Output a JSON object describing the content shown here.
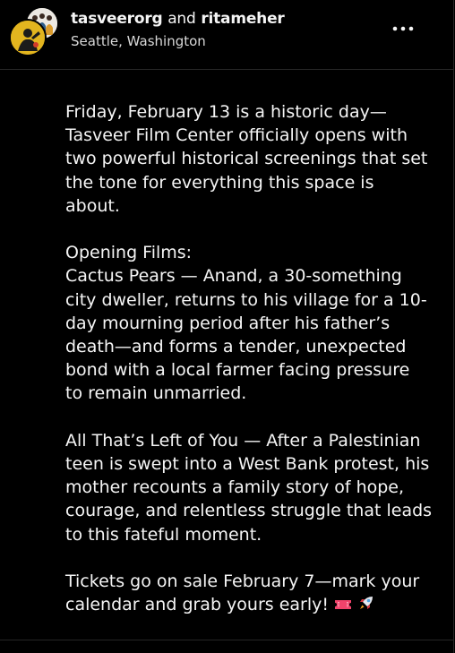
{
  "header": {
    "user_primary": "tasveerorg",
    "conjunction": "and",
    "user_secondary": "ritameher",
    "location": "Seattle, Washington",
    "more_icon": "more-horizontal-icon"
  },
  "caption": {
    "paragraphs": [
      {
        "lines": [
          "Friday, February 13 is a historic day—",
          "Tasveer Film Center officially opens with",
          "two powerful historical screenings that set",
          "the tone for everything this space is",
          "about."
        ]
      },
      {
        "lines": [
          "Opening Films:",
          "Cactus Pears — Anand, a 30-something",
          "city dweller, returns to his village for a 10-",
          "day mourning period after his father’s",
          "death—and forms a tender, unexpected",
          "bond with a local farmer facing pressure",
          "to remain unmarried."
        ]
      },
      {
        "lines": [
          "All That’s Left of You — After a Palestinian",
          "teen is swept into a West Bank protest, his",
          "mother recounts a family story of hope,",
          "courage, and relentless struggle that leads",
          "to this fateful moment."
        ]
      },
      {
        "lines": [
          "Tickets go on sale February 7—mark your",
          "calendar and grab yours early!"
        ]
      }
    ],
    "emoji_icons": [
      "ticket-icon",
      "rocket-icon"
    ]
  },
  "colors": {
    "background": "#000000",
    "text": "#f5f5f5",
    "muted": "#d8d8d8",
    "divider": "#262626",
    "avatar_yellow": "#e3b51f",
    "ticket_pink": "#f0436b"
  }
}
